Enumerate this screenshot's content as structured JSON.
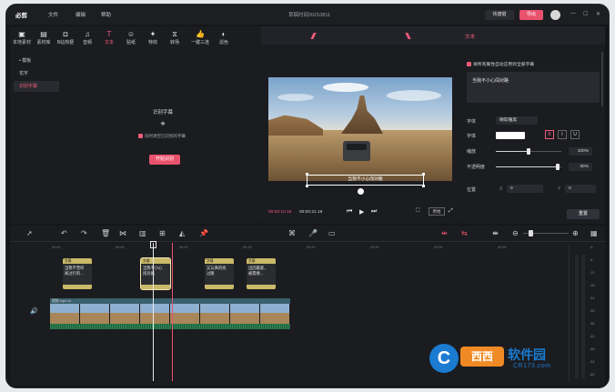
{
  "app": {
    "logo": "必剪",
    "window_title": "草稿时间20210811"
  },
  "menu": [
    "文件",
    "编辑",
    "帮助"
  ],
  "header": {
    "shortcut": "快捷键",
    "export": "导出"
  },
  "toolbar": [
    {
      "label": "本地素材",
      "icon": "folder-icon"
    },
    {
      "label": "素材库",
      "icon": "library-icon"
    },
    {
      "label": "B站热梗",
      "icon": "tv-icon"
    },
    {
      "label": "音频",
      "icon": "music-icon"
    },
    {
      "label": "文本",
      "icon": "text-icon"
    },
    {
      "label": "贴纸",
      "icon": "sticker-icon"
    },
    {
      "label": "特效",
      "icon": "effect-icon"
    },
    {
      "label": "转场",
      "icon": "transition-icon"
    },
    {
      "label": "一键三连",
      "icon": "like-icon"
    },
    {
      "label": "滤色",
      "icon": "filter-icon"
    }
  ],
  "subnav": [
    "• 模板",
    "花字",
    "识别字幕"
  ],
  "recognize": {
    "title": "识别字幕",
    "checkbox": "同时清空已识别的字幕",
    "start": "开始识别"
  },
  "preview": {
    "subtitle": "当我不小心闯对路",
    "timecode_current": "00:00:10.16",
    "timecode_total": "00:00:21.18",
    "original": "原始"
  },
  "props": {
    "title": "文本",
    "apply_all": "将所有属性自动应用到全部字幕",
    "text": "当我不小心闯对路",
    "font_label": "字体",
    "font_value": "微软雅黑",
    "style_label": "字体",
    "format": [
      "B",
      "I",
      "U"
    ],
    "scale_label": "缩放",
    "scale_value": "100%",
    "scale_level": 0.5,
    "opacity_label": "不透明度",
    "opacity_value": "30%",
    "opacity_level": 0.95,
    "position_label": "位置",
    "pos_x_label": "X",
    "pos_x": "0",
    "pos_y_label": "Y",
    "pos_y": "0",
    "reset": "重置"
  },
  "timeline": {
    "ruler": [
      "00:00",
      "00:05",
      "00:10",
      "00:15",
      "00:20",
      "00:25",
      "00:30",
      "00:35",
      "00:40",
      "00:45",
      "00:50"
    ],
    "clips": [
      {
        "head": "字幕",
        "text": "当我不曾听\n闻过行的..."
      },
      {
        "head": "字幕",
        "text": "当我不小心\n闯对路"
      },
      {
        "head": "字幕",
        "text": "又认真的找\n过路"
      },
      {
        "head": "字幕",
        "text": "出因最爱，\n被需要..."
      }
    ],
    "video_label": "视频.mp4  1x",
    "vu_labels": [
      "-3",
      "-6",
      "-12",
      "-18",
      "-24",
      "-30",
      "-36",
      "-42",
      "-48",
      "-54",
      "-60"
    ]
  },
  "watermark": {
    "brand": "西西",
    "name": "软件园",
    "url": "CR173.com"
  }
}
